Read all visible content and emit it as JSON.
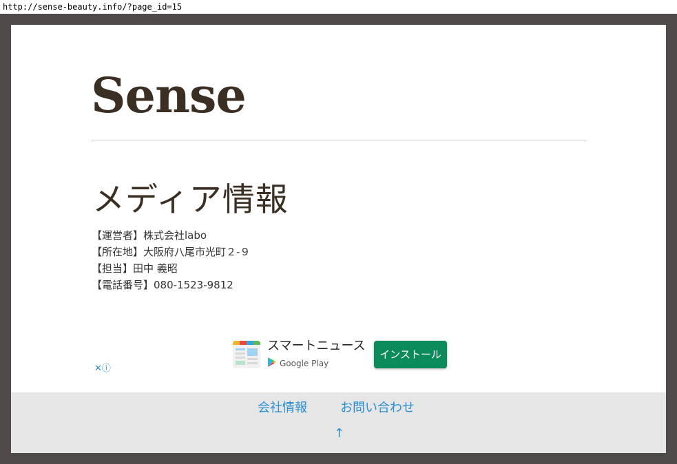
{
  "browser": {
    "url": "http://sense-beauty.info/?page_id=15"
  },
  "site": {
    "title": "Sense"
  },
  "page": {
    "title": "メディア情報",
    "info": [
      "【運営者】株式会社labo",
      "【所在地】大阪府八尾市光町２-９",
      "【担当】田中 義昭",
      "【電話番号】080-1523-9812"
    ]
  },
  "ad": {
    "close_label": "✕ⓘ",
    "app_name": "スマートニュース",
    "store_label": "Google Play",
    "install_label": "インストール",
    "install_color": "#0b8a5a"
  },
  "footer": {
    "links": [
      "会社情報",
      "お問い合わせ"
    ],
    "back_to_top": "↑",
    "link_color": "#2a8fd1"
  }
}
